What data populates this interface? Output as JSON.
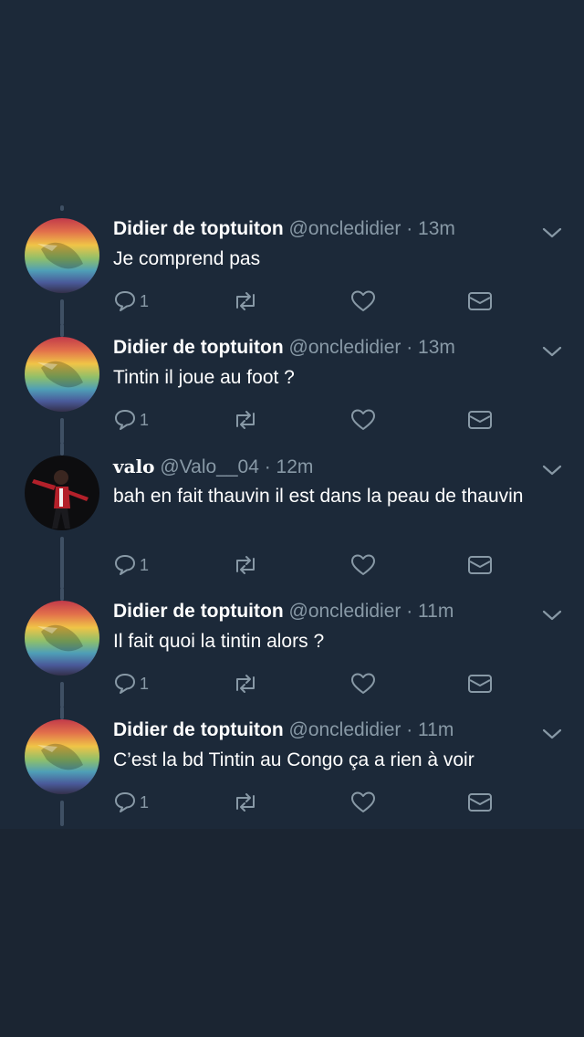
{
  "tweets": [
    {
      "name": "Didier de toptuiton",
      "handle": "@oncledidier",
      "time": "· 13m",
      "text": "Je comprend pas",
      "reply_count": "1",
      "avatar": "rainbow-avatar"
    },
    {
      "name": "Didier de toptuiton",
      "handle": "@oncledidier",
      "time": "· 13m",
      "text": "Tintin il joue au foot ?",
      "reply_count": "1",
      "avatar": "rainbow-avatar"
    },
    {
      "name": "valo",
      "handle": "@Valo__04",
      "time": "· 12m",
      "text": "bah en fait thauvin il est dans la peau de thauvin",
      "reply_count": "1",
      "avatar": "dancer-avatar"
    },
    {
      "name": "Didier de toptuiton",
      "handle": "@oncledidier",
      "time": "· 11m",
      "text": "Il fait quoi la tintin alors ?",
      "reply_count": "1",
      "avatar": "rainbow-avatar"
    },
    {
      "name": "Didier de toptuiton",
      "handle": "@oncledidier",
      "time": "· 11m",
      "text": "C’est la bd Tintin au Congo ça a rien à voir",
      "reply_count": "1",
      "avatar": "rainbow-avatar"
    }
  ],
  "icons": [
    "reply-icon",
    "retweet-icon",
    "like-icon",
    "direct-message-icon",
    "chevron-down-icon"
  ],
  "colors": {
    "background": "#1c2939",
    "text": "#ffffff",
    "secondary": "#8899a6",
    "thread_line": "#3f5064"
  }
}
